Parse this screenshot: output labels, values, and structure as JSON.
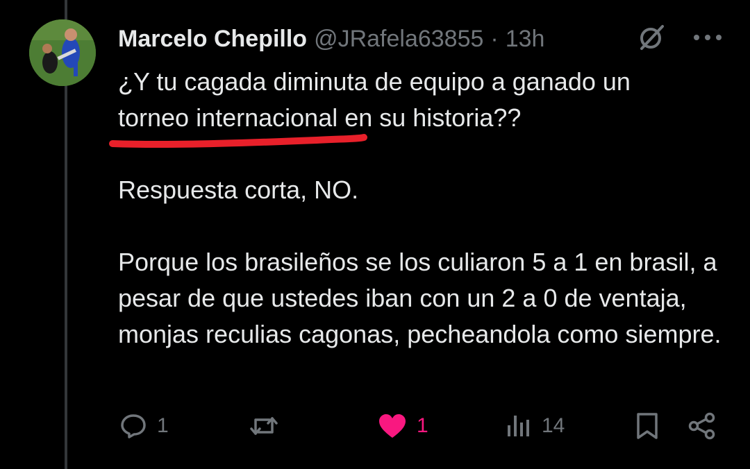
{
  "post": {
    "author_name": "Marcelo Chepillo",
    "handle": "@JRafela63855",
    "separator": "·",
    "time": "13h",
    "text_line1": "¿Y tu cagada diminuta de equipo a ganado un",
    "text_line2": "torneo internacional en su historia??",
    "text_para2": "Respuesta corta, NO.",
    "text_para3": "Porque los brasileños se los culiaron 5 a 1 en brasil, a pesar de que ustedes iban con un 2 a 0 de ventaja, monjas reculias cagonas, pecheandola como siempre."
  },
  "actions": {
    "reply_count": "1",
    "repost_count": "",
    "like_count": "1",
    "views_count": "14"
  },
  "icons": {
    "grok": "grok-icon",
    "more": "more-icon",
    "reply": "reply-icon",
    "repost": "repost-icon",
    "like": "heart-icon",
    "views": "views-icon",
    "bookmark": "bookmark-icon",
    "share": "share-icon"
  },
  "colors": {
    "background": "#000000",
    "text": "#e7e9ea",
    "muted": "#71767b",
    "like": "#f91880",
    "annotation": "#e8202a"
  }
}
